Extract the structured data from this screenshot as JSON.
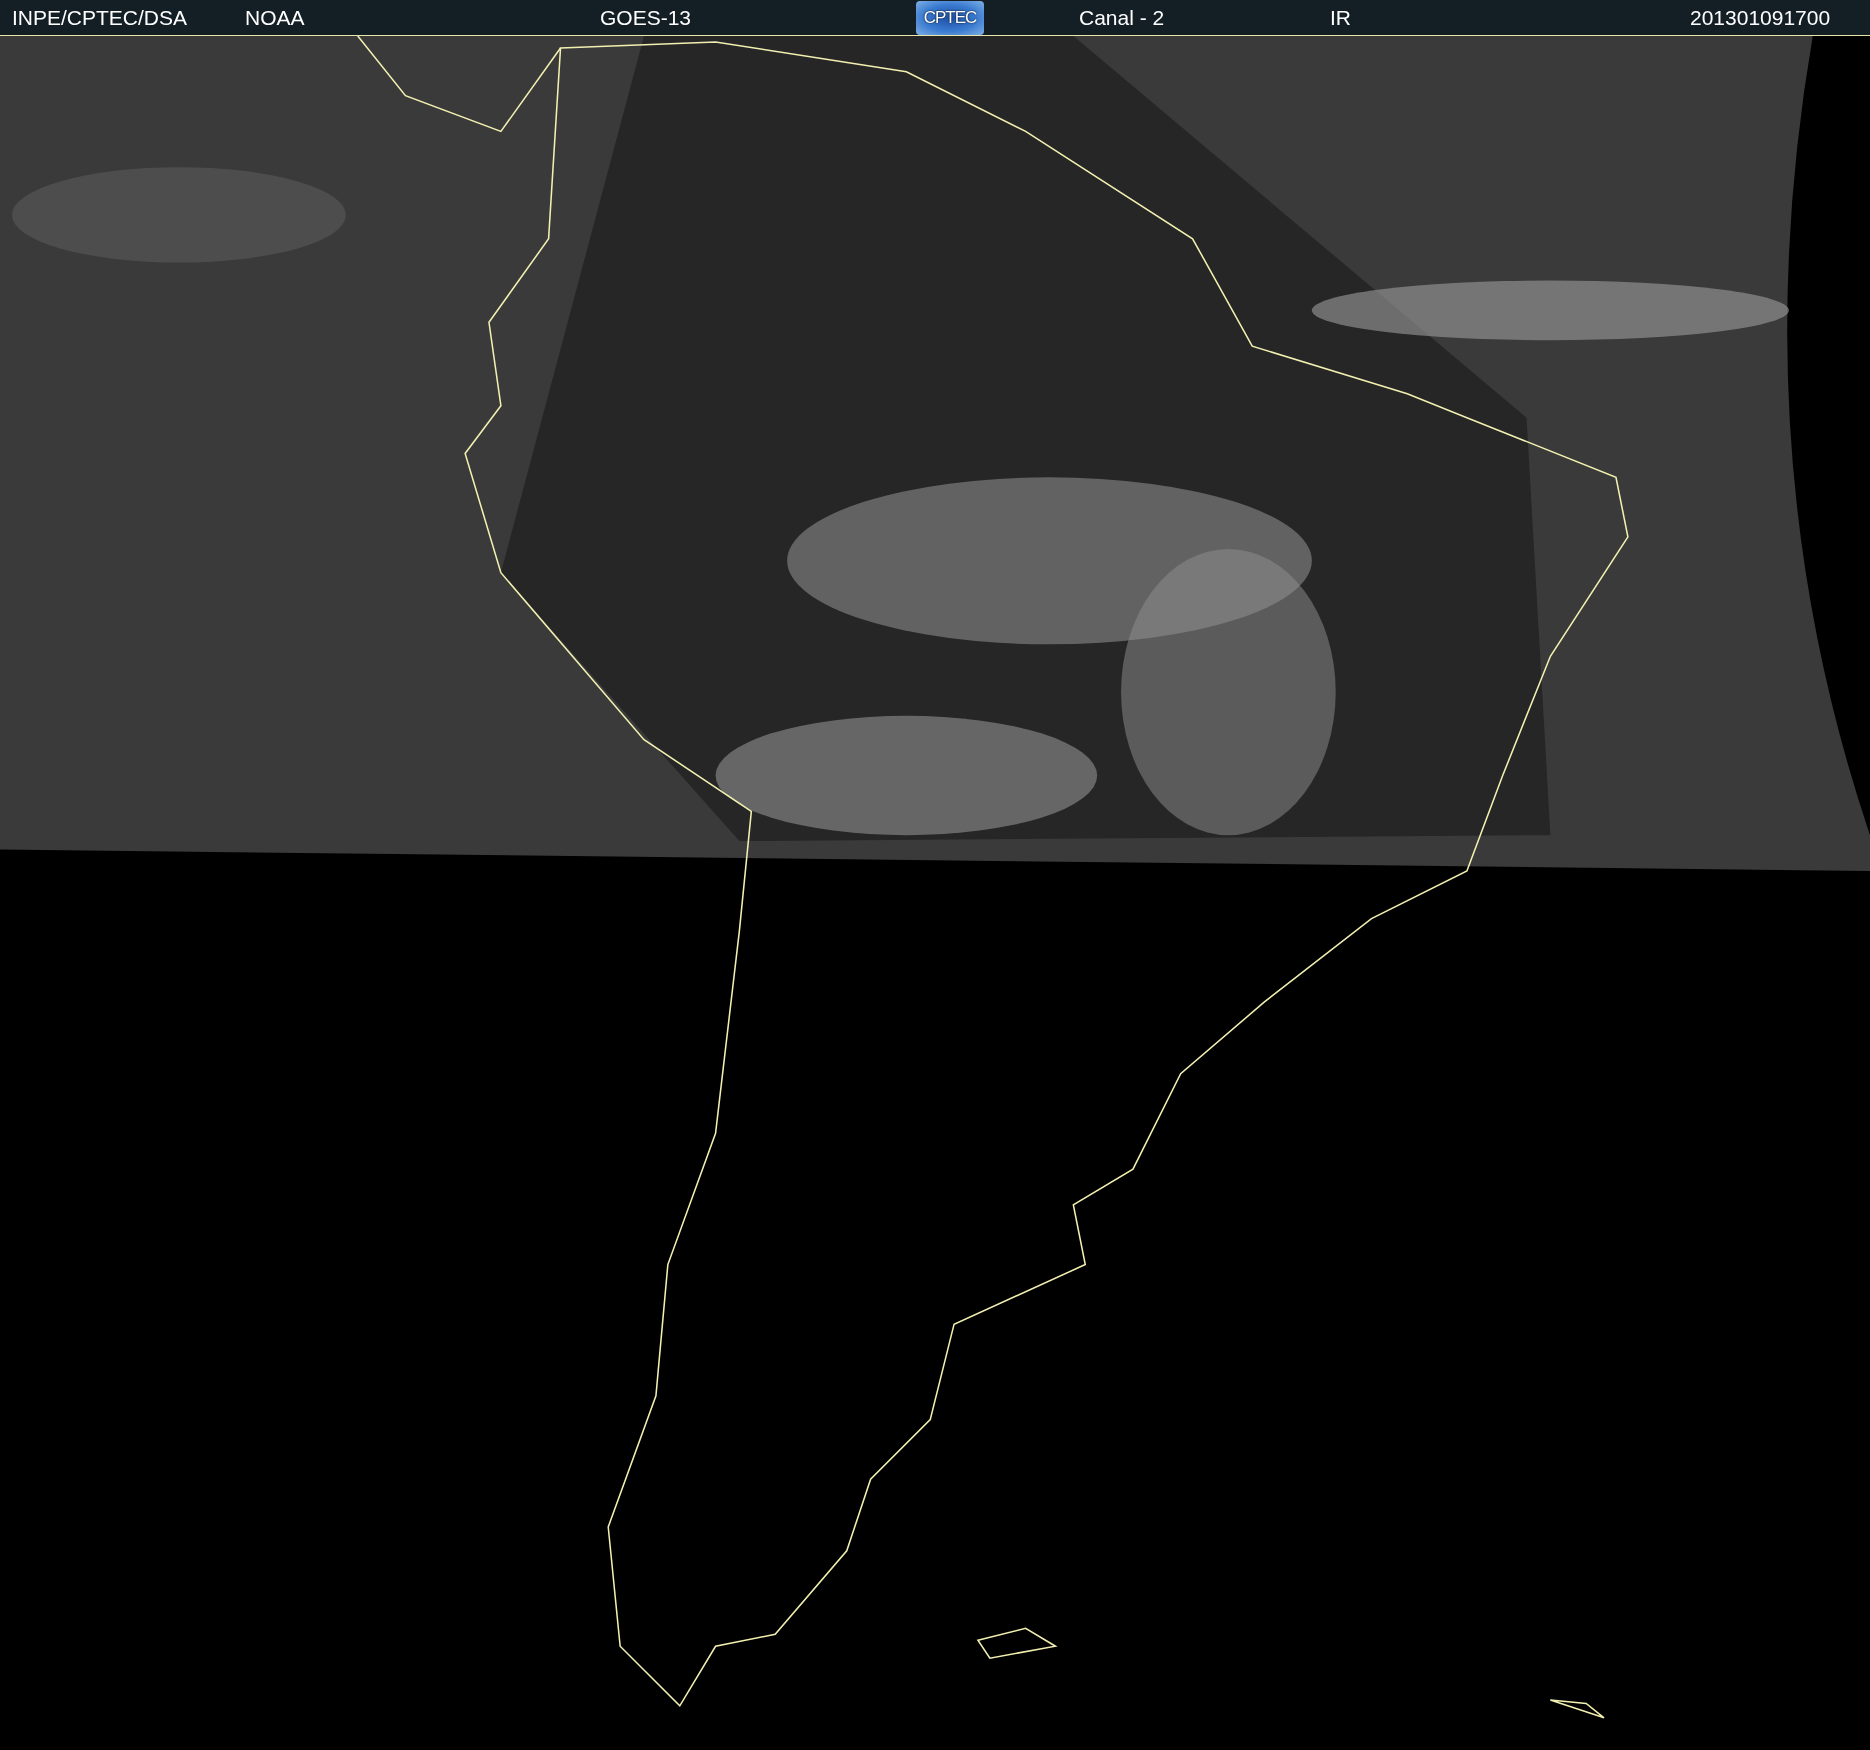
{
  "header": {
    "items": [
      {
        "kind": "text",
        "text": "INPE/CPTEC/DSA"
      },
      {
        "kind": "text",
        "text": "NOAA"
      },
      {
        "kind": "text",
        "text": "GOES-13"
      },
      {
        "kind": "logo",
        "text": "CPTEC"
      },
      {
        "kind": "text",
        "text": "Canal - 2"
      },
      {
        "kind": "text",
        "text": "IR"
      },
      {
        "kind": "text",
        "text": "201301091700"
      }
    ]
  }
}
